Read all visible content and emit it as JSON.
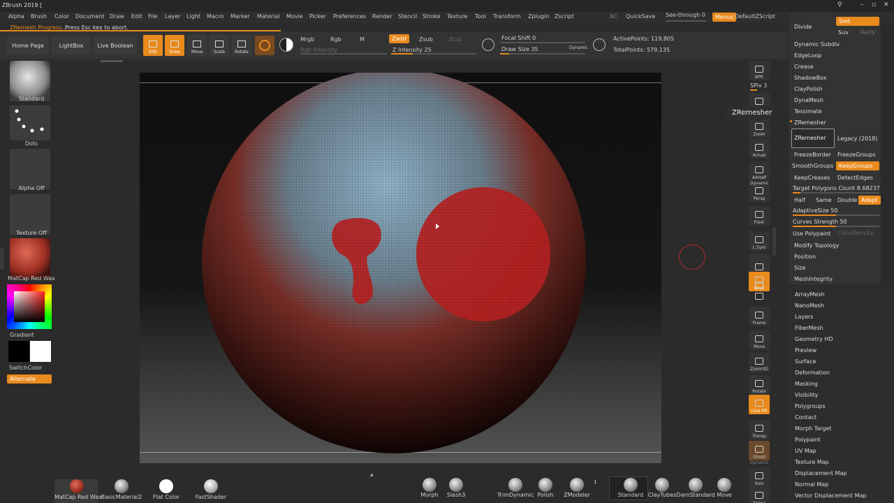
{
  "window": {
    "title": "ZBrush 2019 ["
  },
  "menubar": {
    "items": [
      "Alpha",
      "Brush",
      "Color",
      "Document",
      "Draw",
      "Edit",
      "File",
      "Layer",
      "Light",
      "Macro",
      "Marker",
      "Material",
      "Movie",
      "Picker",
      "Preferences",
      "Render",
      "Stencil",
      "Stroke",
      "Texture",
      "Tool",
      "Transform",
      "Zplugin",
      "Zscript"
    ],
    "ac": "AC",
    "quicksave": "QuickSave",
    "see_through": "See-through  0",
    "see_through_value": 0,
    "menus": "Menus",
    "default_zscript": "DefaultZScript"
  },
  "progress": {
    "title": "ZRemesh Progress...",
    "hint": "Press Esc key to abort.",
    "fraction": 0.98
  },
  "toolbar": {
    "home_page": "Home Page",
    "lightbox": "LightBox",
    "live_boolean": "Live Boolean",
    "tools": [
      {
        "label": "Edit",
        "active": true
      },
      {
        "label": "Draw",
        "active": true
      },
      {
        "label": "Move",
        "active": false
      },
      {
        "label": "Scale",
        "active": false
      },
      {
        "label": "Rotate",
        "active": false
      }
    ],
    "mrgb": "Mrgb",
    "rgb": "Rgb",
    "m": "M",
    "zadd": "Zadd",
    "zsub": "Zsub",
    "zcut": "Zcut",
    "rgb_intensity": "Rgb Intensity",
    "z_intensity": "Z Intensity 25",
    "z_intensity_value": 25,
    "focal_shift": "Focal Shift 0",
    "focal_shift_value": 0,
    "draw_size": "Draw Size 35",
    "draw_size_value": 35,
    "dynamic": "Dynamic",
    "active_points": "ActivePoints: 119,805",
    "total_points": "TotalPoints: 579,135"
  },
  "left_shelf": {
    "brush": "Standard",
    "stroke": "Dots",
    "alpha": "Alpha Off",
    "texture": "Texture Off",
    "material": "MatCap Red Wax",
    "gradient": "Gradient",
    "switch_color": "SwitchColor",
    "alternate": "Alternate"
  },
  "right_shelf": {
    "spix": "SPix 3",
    "spix_value": 3,
    "tooltip": "ZRemesher",
    "buttons": [
      "BPR",
      "Scroll",
      "Zoom",
      "Actual",
      "AAHalf",
      "Persp",
      "Floor",
      "L.Sym",
      "",
      "Qxyz",
      "",
      "",
      "Frame",
      "Move",
      "Zoom3D",
      "Rotate",
      "Line Fill",
      "Transp",
      "Ghost",
      "Solo",
      "Xpose"
    ],
    "dynamic_label": "Dynamic",
    "polyf_label": "Line Fill",
    "polyf_sub": "PolyF"
  },
  "palette": {
    "divide": "Divide",
    "smt": "Smt",
    "suv": "Suv",
    "reuv": "ReUV",
    "items": [
      "Dynamic Subdiv",
      "EdgeLoop",
      "Crease",
      "ShadowBox",
      "ClayPolish",
      "DynaMesh",
      "Tessimate",
      "ZRemesher"
    ],
    "zremesher_btn": "ZRemesher",
    "legacy": "Legacy (2018)",
    "freeze_border": "FreezeBorder",
    "freeze_groups": "FreezeGroups",
    "smooth_groups": "SmoothGroups",
    "keep_groups": "KeepGroups",
    "keep_creases": "KeepCreases",
    "detect_edges": "DetectEdges",
    "target_polygons": "Target Polygons Count 8.68237",
    "target_polygons_value": 8.68237,
    "half": "Half",
    "same": "Same",
    "double": "Double",
    "adapt": "Adapt",
    "adaptive_size": "AdaptiveSize 50",
    "adaptive_size_value": 50,
    "curves_strength": "Curves Strength 50",
    "curves_strength_value": 50,
    "use_polypaint": "Use Polypaint",
    "color_density": "ColorDensity",
    "after": [
      "Modify Topology",
      "Position",
      "Size",
      "MeshIntegrity"
    ]
  },
  "subpalettes": [
    "ArrayMesh",
    "NanoMesh",
    "Layers",
    "FiberMesh",
    "Geometry HD",
    "Preview",
    "Surface",
    "Deformation",
    "Masking",
    "Visibility",
    "Polygroups",
    "Contact",
    "Morph Target",
    "Polypaint",
    "UV Map",
    "Texture Map",
    "Displacement Map",
    "Normal Map",
    "Vector Displacement Map"
  ],
  "bottom_shelf": {
    "materials": [
      "MatCap Red Wax",
      "BasicMaterial2",
      "Flat Color",
      "FastShader"
    ],
    "brushes": [
      "Morph",
      "Slash3",
      "TrimDynamic",
      "Polish",
      "ZModeler",
      "Standard",
      "ClayTubes",
      "DamStandard",
      "Move"
    ],
    "zmodeler_badge": "1"
  },
  "colors": {
    "accent": "#e98a1d",
    "mask_red": "#b82222",
    "sphere_blue": "#8fb3c9",
    "sphere_red": "#7a2f28"
  }
}
